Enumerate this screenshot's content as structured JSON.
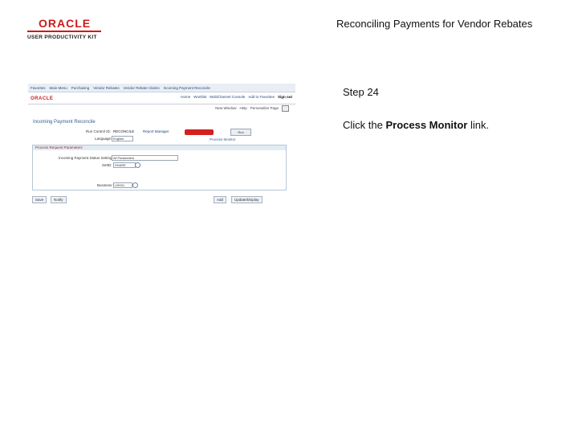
{
  "slide": {
    "logo_brand": "ORACLE",
    "logo_sub": "USER PRODUCTIVITY KIT",
    "title": "Reconciling Payments for Vendor Rebates",
    "step": "Step 24",
    "instruction_prefix": "Click the ",
    "instruction_bold": "Process Monitor",
    "instruction_suffix": " link."
  },
  "app": {
    "topnav": [
      "Favorites",
      "Main Menu",
      "Purchasing",
      "Vendor Rebates",
      "Vendor Rebate Claims",
      "Incoming Payment Reconcile"
    ],
    "brand": "ORACLE",
    "toplinks": [
      "Home",
      "Worklist",
      "MultiChannel Console",
      "Add to Favorites",
      "Sign out"
    ],
    "subbar": [
      "New Window",
      "Help",
      "Personalize Page"
    ],
    "page_title": "Incoming Payment Reconcile",
    "run_control_label": "Run Control ID:",
    "run_control_value": "RECONCILE",
    "language_label": "Language:",
    "language_value": "English",
    "report_manager": "Report Manager",
    "run_label": "Run",
    "process_monitor": "Process Monitor",
    "panel_title": "Process Request Parameters",
    "incoming_label": "Incoming Payment Status Setting:",
    "incoming_value": "All Parameters",
    "setid_label": "SetID:",
    "setid_value": "SHARE",
    "business_unit_label": "Business Unit:",
    "business_unit_value": "US001",
    "save_label": "Save",
    "notify_label": "Notify",
    "add_label": "Add",
    "update_label": "Update/Display"
  }
}
